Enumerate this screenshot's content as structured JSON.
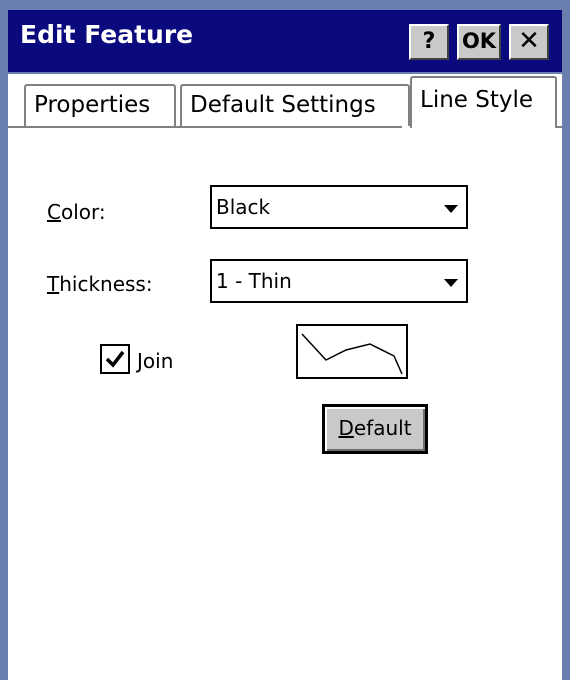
{
  "window": {
    "title": "Edit Feature",
    "help_label": "?",
    "ok_label": "OK",
    "close_label": "✕"
  },
  "tabs": [
    {
      "label": "Properties",
      "selected": false
    },
    {
      "label": "Default Settings",
      "selected": false
    },
    {
      "label": "Line Style",
      "selected": true
    }
  ],
  "form": {
    "color_label_prefix": "C",
    "color_label_rest": "olor:",
    "color_value": "Black",
    "thickness_label_prefix": "T",
    "thickness_label_rest": "hickness:",
    "thickness_value": "1 - Thin",
    "join_label_prefix": "J",
    "join_label_rest": "oin",
    "join_checked": true,
    "default_prefix": "D",
    "default_rest": "efault"
  },
  "colors": {
    "titlebar": "#0a0a7e",
    "frame": "#6b7fae",
    "button_face": "#c9c9c9"
  }
}
